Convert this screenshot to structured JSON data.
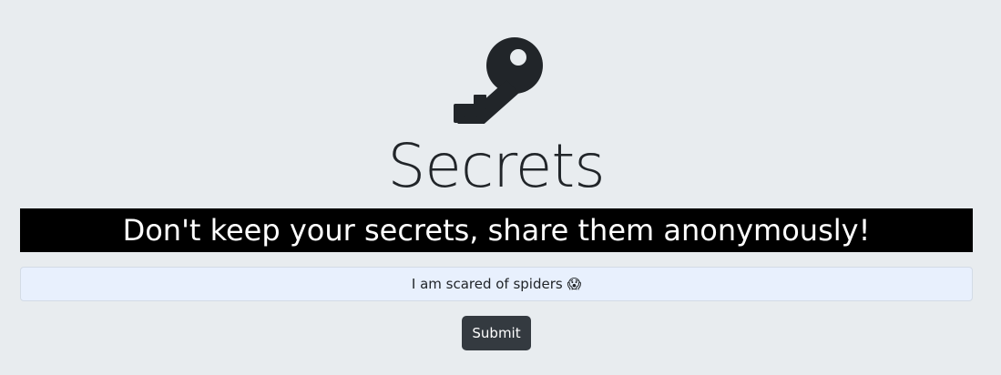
{
  "header": {
    "icon": "key-icon",
    "title": "Secrets",
    "tagline": "Don't keep your secrets, share them anonymously!"
  },
  "form": {
    "secret_value": "I am scared of spiders 😱",
    "submit_label": "Submit"
  },
  "colors": {
    "background": "#e8ecef",
    "banner_background": "#000000",
    "button_background": "#343a40",
    "input_background": "#e8f0fd"
  }
}
